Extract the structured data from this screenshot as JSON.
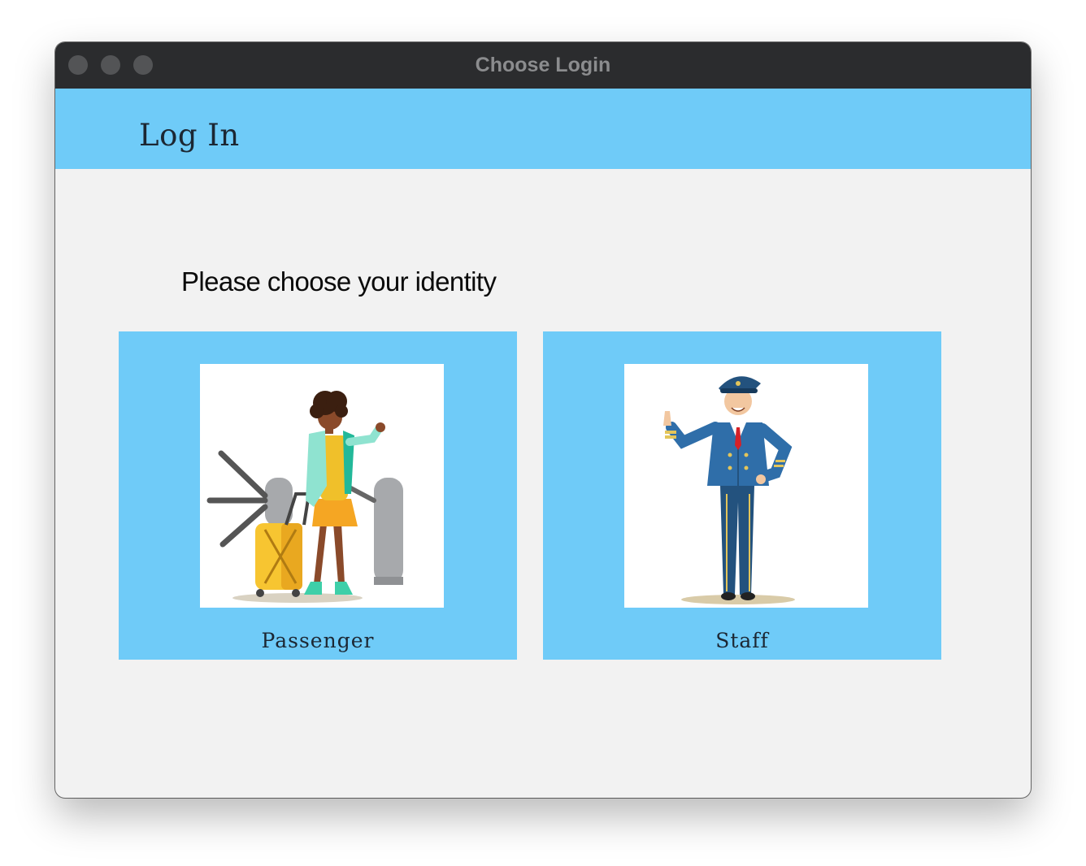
{
  "window": {
    "title": "Choose Login",
    "traffic_lights": [
      "close-button",
      "minimize-button",
      "zoom-button"
    ]
  },
  "header": {
    "title": "Log In"
  },
  "main": {
    "prompt": "Please choose your identity",
    "options": [
      {
        "label": "Passenger",
        "illustration": "passenger-illustration"
      },
      {
        "label": "Staff",
        "illustration": "pilot-illustration"
      }
    ]
  },
  "colors": {
    "accent": "#6fcbf8",
    "titlebar": "#2b2c2e",
    "background": "#f2f2f2"
  }
}
